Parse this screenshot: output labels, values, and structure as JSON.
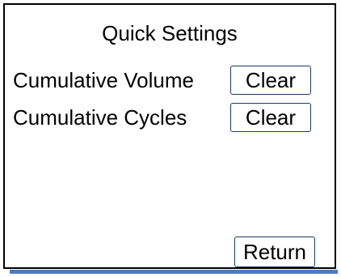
{
  "title": "Quick Settings",
  "rows": [
    {
      "label": "Cumulative Volume",
      "button": "Clear"
    },
    {
      "label": "Cumulative Cycles",
      "button": "Clear"
    }
  ],
  "footer": {
    "return_label": "Return"
  },
  "colors": {
    "border": "#000000",
    "button_border": "#1e3a60",
    "accent_bar": "#4a7cc0"
  }
}
